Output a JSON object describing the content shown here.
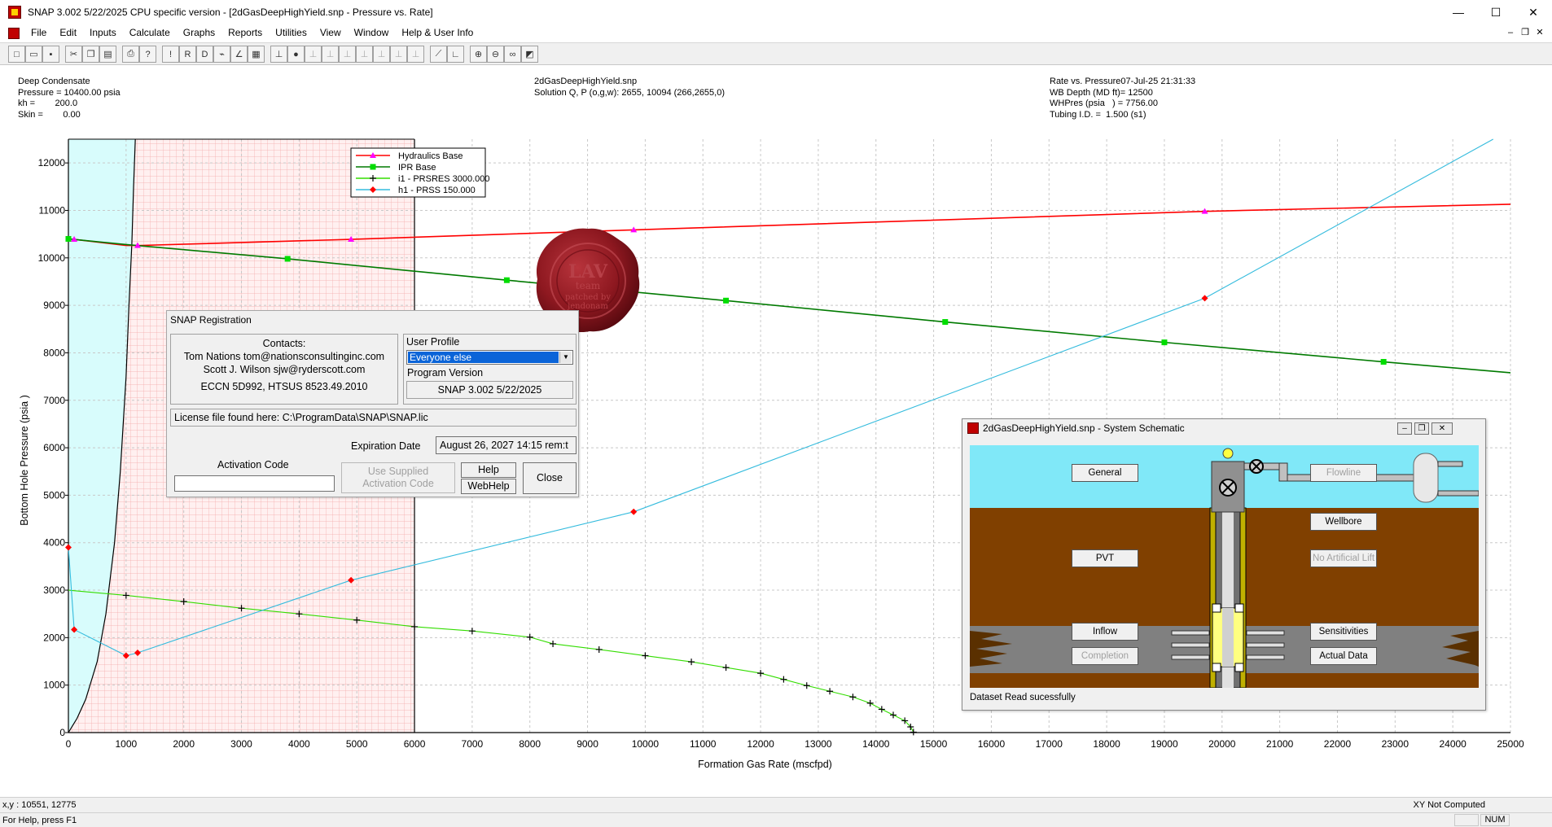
{
  "window": {
    "title": "SNAP 3.002 5/22/2025 CPU specific version - [2dGasDeepHighYield.snp - Pressure vs. Rate]",
    "controls": [
      "—",
      "☐",
      "✕"
    ]
  },
  "menubar": {
    "items": [
      "File",
      "Edit",
      "Inputs",
      "Calculate",
      "Graphs",
      "Reports",
      "Utilities",
      "View",
      "Window",
      "Help & User Info"
    ],
    "mdi_controls": [
      "–",
      "❐",
      "✕"
    ]
  },
  "toolbar": {
    "buttons": [
      {
        "icon": "new-icon",
        "glyph": "□"
      },
      {
        "icon": "open-icon",
        "glyph": "▭"
      },
      {
        "icon": "save-icon",
        "glyph": "▪"
      },
      {
        "icon": "cut-icon",
        "glyph": "✂"
      },
      {
        "icon": "copy-icon",
        "glyph": "❐"
      },
      {
        "icon": "paste-icon",
        "glyph": "▤"
      },
      {
        "icon": "print-icon",
        "glyph": "⎙"
      },
      {
        "icon": "help-icon",
        "glyph": "?"
      },
      {
        "icon": "pin-icon",
        "glyph": "!"
      },
      {
        "icon": "pr-icon",
        "glyph": "R"
      },
      {
        "icon": "pd-icon",
        "glyph": "D"
      },
      {
        "icon": "pump-icon",
        "glyph": "⌁"
      },
      {
        "icon": "chart-icon",
        "glyph": "∠"
      },
      {
        "icon": "report-icon",
        "glyph": "▦"
      },
      {
        "icon": "well-1-icon",
        "glyph": "⊥"
      },
      {
        "icon": "well-2-icon",
        "glyph": "●"
      },
      {
        "icon": "well-3-icon",
        "glyph": "⊥"
      },
      {
        "icon": "well-4-icon",
        "glyph": "⊥"
      },
      {
        "icon": "well-5-icon",
        "glyph": "⊥"
      },
      {
        "icon": "well-6-icon",
        "glyph": "⊥"
      },
      {
        "icon": "well-7-icon",
        "glyph": "⊥"
      },
      {
        "icon": "well-8-icon",
        "glyph": "⊥"
      },
      {
        "icon": "well-9-icon",
        "glyph": "⊥"
      },
      {
        "icon": "curve-1-icon",
        "glyph": "⟋"
      },
      {
        "icon": "curve-2-icon",
        "glyph": "∟"
      },
      {
        "icon": "zoom-in-icon",
        "glyph": "⊕"
      },
      {
        "icon": "zoom-out-icon",
        "glyph": "⊖"
      },
      {
        "icon": "binoculars-icon",
        "glyph": "∞"
      },
      {
        "icon": "color-icon",
        "glyph": "◩"
      }
    ]
  },
  "header": {
    "left": "Deep Condensate\nPressure = 10400.00 psia\nkh =        200.0\nSkin =        0.00",
    "center": "2dGasDeepHighYield.snp\nSolution Q, P (o,g,w): 2655, 10094 (266,2655,0)",
    "right": "Rate vs. Pressure07-Jul-25 21:31:33\nWB Depth (MD ft)= 12500\nWHPres (psia   ) = 7756.00\nTubing I.D. =  1.500 (s1)"
  },
  "chart_data": {
    "type": "line",
    "xlabel": "Formation Gas Rate (mscfpd)",
    "ylabel": "Bottom Hole Pressure (psia   )",
    "xlim": [
      0,
      25000
    ],
    "ylim": [
      0,
      12500
    ],
    "xticks": [
      0,
      1000,
      2000,
      3000,
      4000,
      5000,
      6000,
      7000,
      8000,
      9000,
      10000,
      11000,
      12000,
      13000,
      14000,
      15000,
      16000,
      17000,
      18000,
      19000,
      20000,
      21000,
      22000,
      23000,
      24000,
      25000
    ],
    "yticks": [
      0,
      1000,
      2000,
      3000,
      4000,
      5000,
      6000,
      7000,
      8000,
      9000,
      10000,
      11000,
      12000
    ],
    "grid": true,
    "legend_position": "top-left",
    "shaded_region_x": [
      0,
      6000
    ],
    "series": [
      {
        "name": "Hydraulics Base",
        "color": "#ff0000",
        "marker": "triangle",
        "marker_color": "#ff00ff",
        "points": [
          [
            0,
            10400
          ],
          [
            100,
            10390
          ],
          [
            1000,
            10260
          ],
          [
            1200,
            10260
          ],
          [
            4900,
            10390
          ],
          [
            9800,
            10590
          ],
          [
            19700,
            10980
          ],
          [
            25000,
            11130
          ]
        ],
        "marker_x": [
          100,
          1200,
          4900,
          9800,
          19700
        ]
      },
      {
        "name": "IPR Base",
        "color": "#007a00",
        "marker": "square",
        "marker_color": "#00dd00",
        "points": [
          [
            0,
            10400
          ],
          [
            1000,
            10280
          ],
          [
            3800,
            9980
          ],
          [
            7600,
            9530
          ],
          [
            11400,
            9100
          ],
          [
            15200,
            8650
          ],
          [
            19000,
            8220
          ],
          [
            22800,
            7810
          ],
          [
            25000,
            7580
          ]
        ],
        "marker_x": [
          0,
          3800,
          7600,
          11400,
          15200,
          19000,
          22800
        ]
      },
      {
        "name": "i1 - PRSRES 3000.000",
        "color": "#33dd00",
        "marker": "plus",
        "marker_color": "#000000",
        "points": [
          [
            0,
            3000
          ],
          [
            1000,
            2890
          ],
          [
            2000,
            2760
          ],
          [
            3000,
            2620
          ],
          [
            4000,
            2500
          ],
          [
            5000,
            2370
          ],
          [
            6000,
            2230
          ],
          [
            7000,
            2140
          ],
          [
            8000,
            2010
          ],
          [
            8400,
            1870
          ],
          [
            9200,
            1750
          ],
          [
            10000,
            1620
          ],
          [
            10800,
            1490
          ],
          [
            11400,
            1370
          ],
          [
            12000,
            1250
          ],
          [
            12400,
            1120
          ],
          [
            12800,
            990
          ],
          [
            13200,
            870
          ],
          [
            13600,
            750
          ],
          [
            13900,
            620
          ],
          [
            14100,
            490
          ],
          [
            14300,
            370
          ],
          [
            14500,
            250
          ],
          [
            14600,
            120
          ],
          [
            14650,
            10
          ]
        ],
        "marker_x": [
          1000,
          2000,
          3000,
          4000,
          5000,
          6000,
          7000,
          8000,
          8400,
          9200,
          10000,
          10800,
          11400,
          12000,
          12400,
          12800,
          13200,
          13600,
          13900,
          14100,
          14300,
          14500,
          14600,
          14650
        ]
      },
      {
        "name": "h1 - PRSS 150.000",
        "color": "#33bbdd",
        "marker": "diamond",
        "marker_color": "#ff0000",
        "points": [
          [
            0,
            3900
          ],
          [
            100,
            2170
          ],
          [
            1000,
            1620
          ],
          [
            1200,
            1680
          ],
          [
            4900,
            3210
          ],
          [
            9800,
            4650
          ],
          [
            19700,
            9150
          ],
          [
            24700,
            12500
          ]
        ],
        "marker_x": [
          0,
          100,
          1000,
          1200,
          4900,
          9800,
          19700
        ]
      }
    ],
    "ipr_curve": {
      "color": "#000000",
      "points": [
        [
          0,
          0
        ],
        [
          150,
          300
        ],
        [
          300,
          700
        ],
        [
          500,
          1500
        ],
        [
          650,
          2500
        ],
        [
          800,
          4000
        ],
        [
          900,
          5500
        ],
        [
          1000,
          7500
        ],
        [
          1050,
          9000
        ],
        [
          1100,
          10300
        ],
        [
          1130,
          11500
        ],
        [
          1160,
          12500
        ]
      ]
    }
  },
  "status": {
    "coords": "x,y :  10551,   12775",
    "xy_status": "XY Not Computed",
    "help": "For Help, press F1",
    "num": "NUM"
  },
  "registration": {
    "title": "SNAP Registration",
    "contacts_label": "Contacts:",
    "contact1": "Tom Nations tom@nationsconsultinginc.com",
    "contact2": "Scott J. Wilson sjw@ryderscott.com",
    "eccn": "ECCN 5D992, HTSUS 8523.49.2010",
    "user_profile_label": "User Profile",
    "user_profile_value": "Everyone else",
    "program_version_label": "Program Version",
    "program_version": "SNAP 3.002 5/22/2025",
    "license": "License file found here: C:\\ProgramData\\SNAP\\SNAP.lic",
    "expiration_label": "Expiration Date",
    "expiration_value": "August 26, 2027 14:15 rem:t",
    "activation_label": "Activation Code",
    "activation_value": "",
    "use_supplied_line1": "Use Supplied",
    "use_supplied_line2": "Activation Code",
    "help_button": "Help",
    "webhelp_button": "WebHelp",
    "close_button": "Close"
  },
  "schematic": {
    "title": "2dGasDeepHighYield.snp - System Schematic",
    "buttons": {
      "general": "General",
      "flowline": "Flowline",
      "wellbore": "Wellbore",
      "pvt": "PVT",
      "artificial_lift": "No Artificial Lift",
      "inflow": "Inflow",
      "sensitivities": "Sensitivities",
      "completion": "Completion",
      "actual_data": "Actual Data"
    },
    "status": "Dataset Read sucessfully",
    "colors": {
      "sky": "#80e8f8",
      "earth": "#804000",
      "rock": "#808080"
    }
  },
  "seal": {
    "lines": [
      "LAV",
      "team",
      "patched by",
      "jendonam"
    ]
  }
}
